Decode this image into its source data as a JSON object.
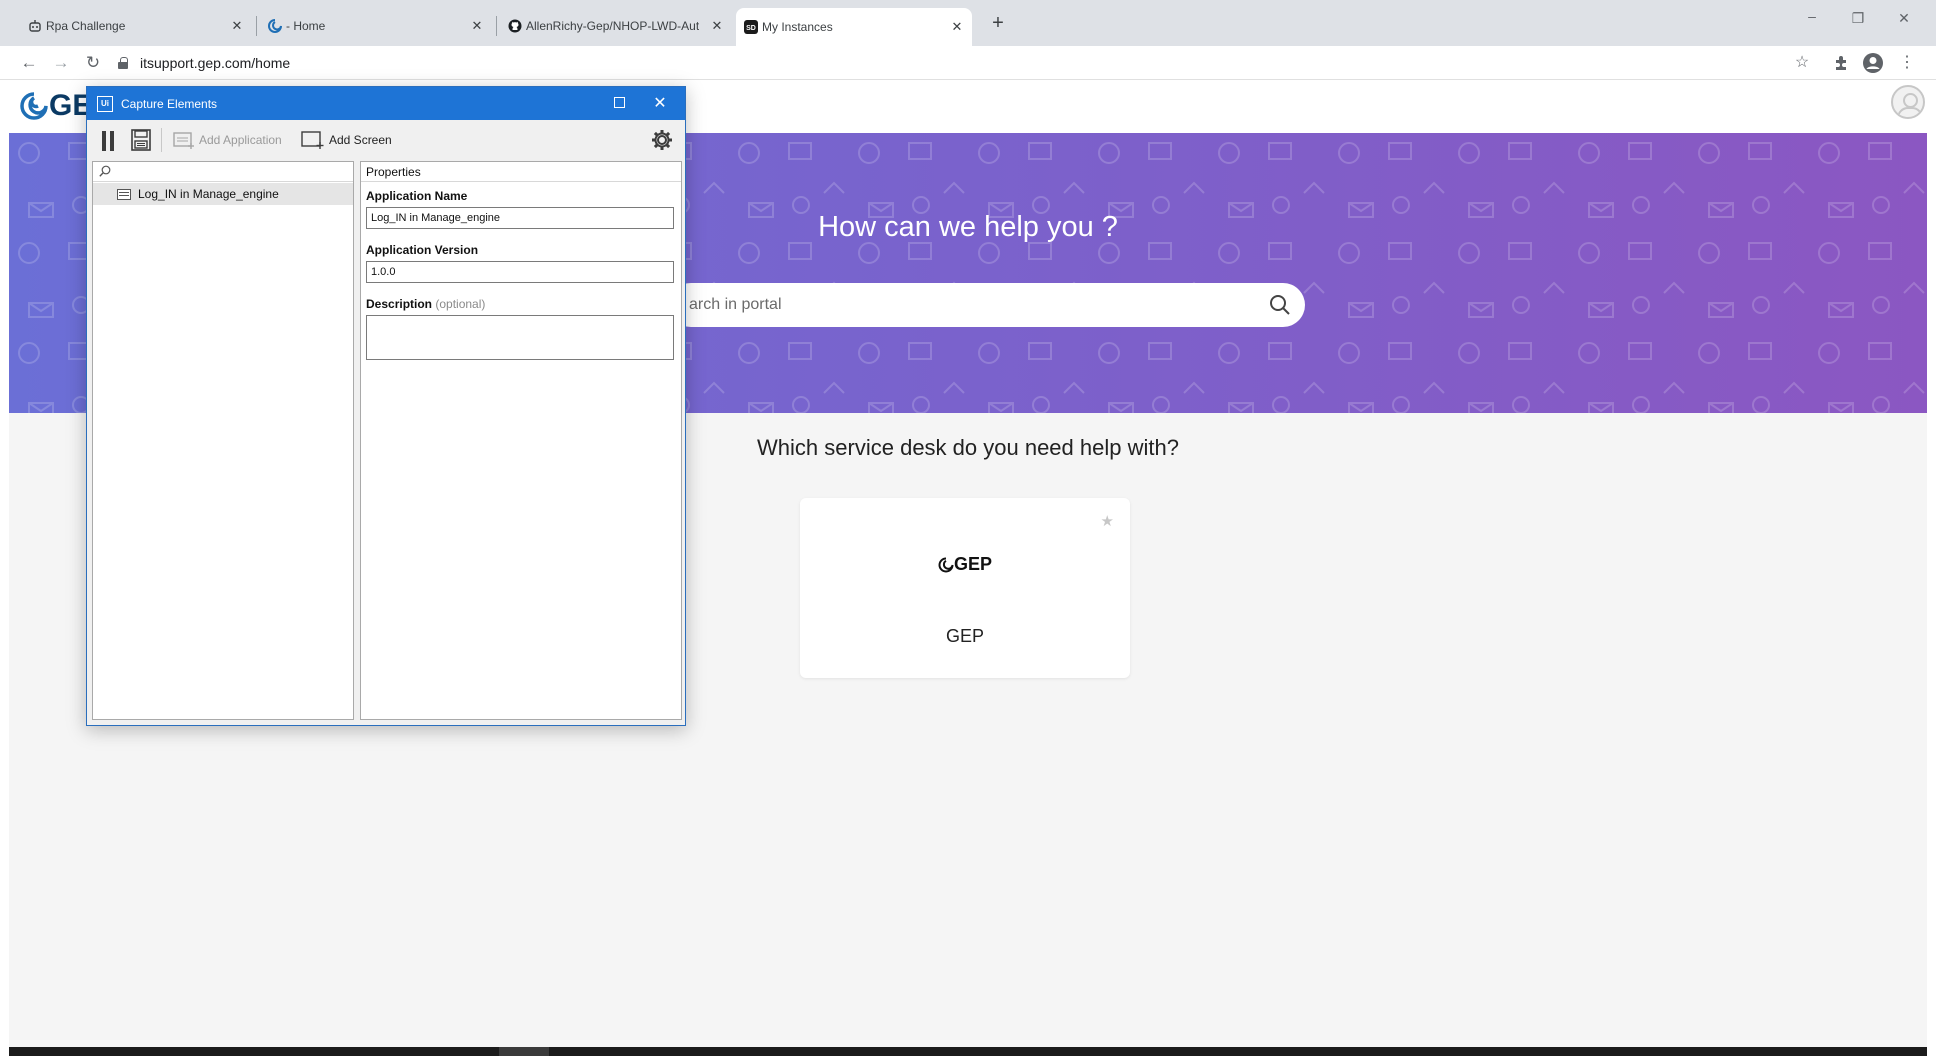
{
  "browser": {
    "tabs": [
      {
        "label": "Rpa Challenge",
        "icon": "robot-icon"
      },
      {
        "label": "- Home",
        "icon": "gep-swirl-icon"
      },
      {
        "label": "AllenRichy-Gep/NHOP-LWD-Aut",
        "icon": "github-icon"
      },
      {
        "label": "My Instances",
        "icon": "sd-icon",
        "active": true
      }
    ],
    "url": "itsupport.gep.com/home"
  },
  "site": {
    "logo_text": "GE",
    "hero_title": "How can we help you ?",
    "search_placeholder": "arch in portal",
    "service_question": "Which service desk do you need help with?",
    "card": {
      "logo_text": "GEP",
      "name": "GEP"
    }
  },
  "dialog": {
    "title": "Capture Elements",
    "app_icon_text": "Ui",
    "toolbar": {
      "add_application": "Add Application",
      "add_screen": "Add Screen"
    },
    "tree": {
      "items": [
        "Log_IN in Manage_engine"
      ]
    },
    "properties": {
      "header": "Properties",
      "app_name_label": "Application Name",
      "app_name_value": "Log_IN in Manage_engine",
      "app_version_label": "Application Version",
      "app_version_value": "1.0.0",
      "description_label": "Description",
      "description_optional": "(optional)",
      "description_value": ""
    }
  },
  "colors": {
    "dialog_title_bar": "#1e74d6",
    "hero_gradient_start": "#6b6fd6",
    "hero_gradient_end": "#8b57c2",
    "brand_navy": "#0b3a64"
  }
}
